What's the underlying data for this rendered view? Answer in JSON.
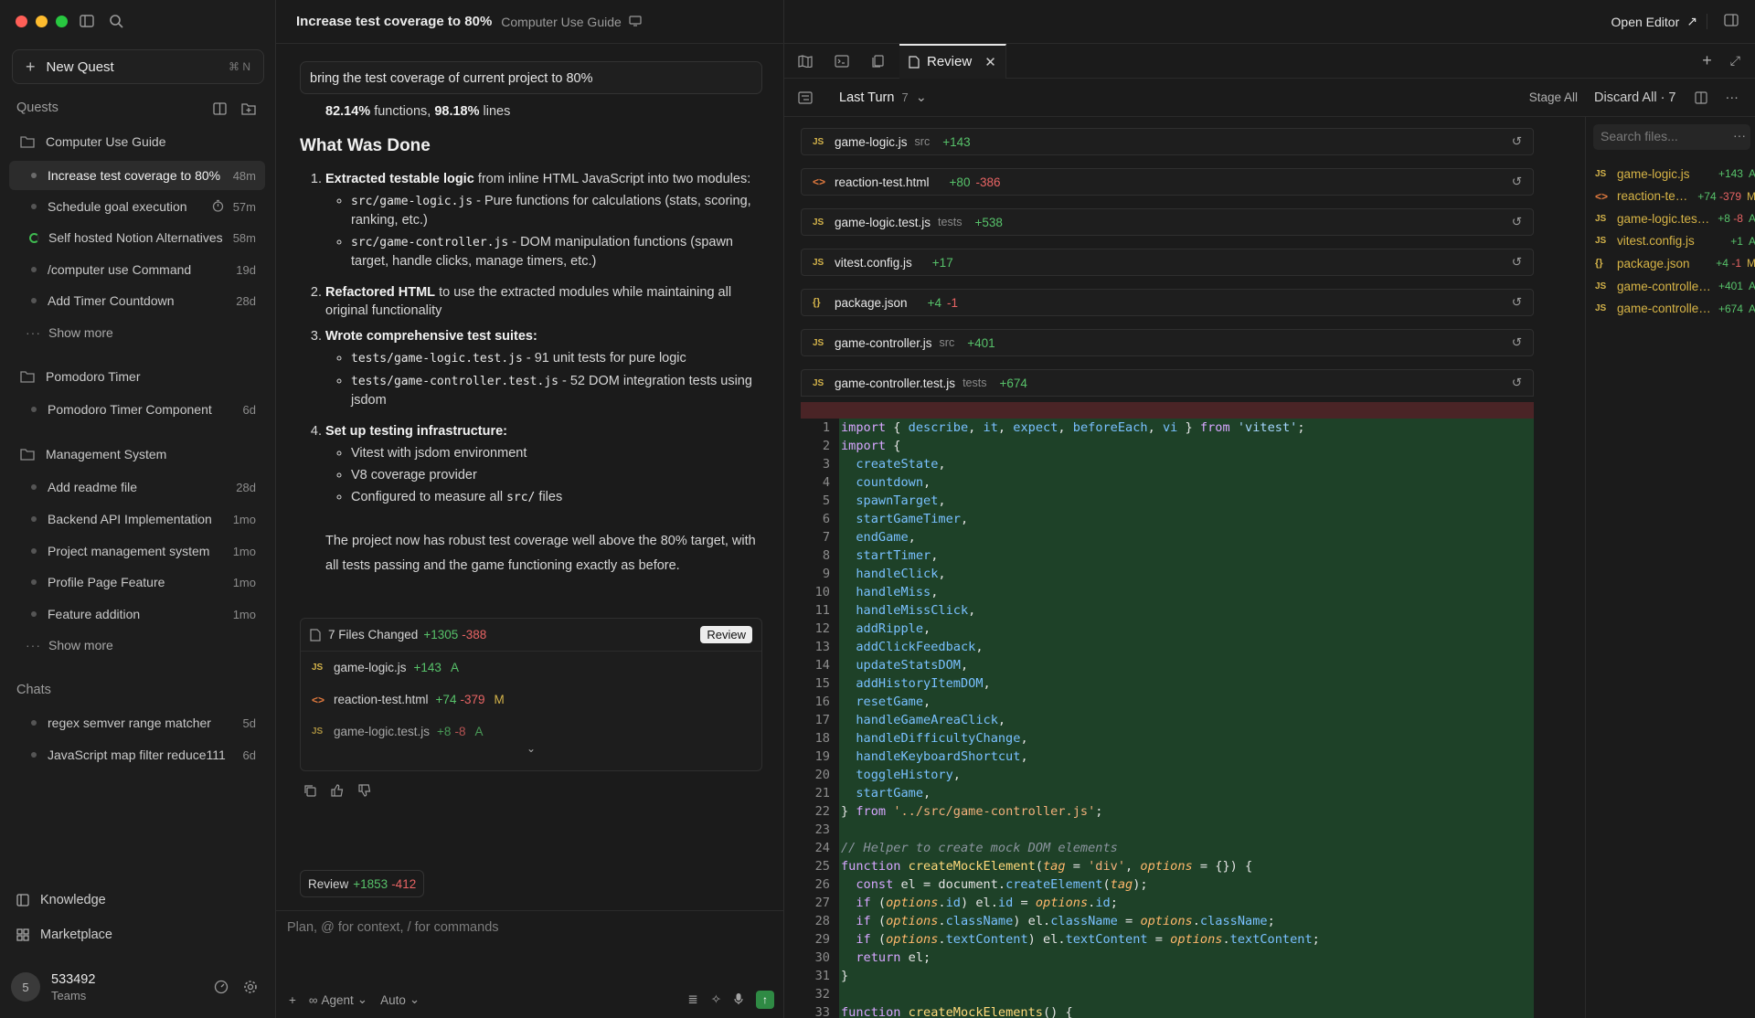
{
  "sidebar": {
    "new_quest": "New Quest",
    "new_quest_kbd": "⌘ N",
    "quests_title": "Quests",
    "groups": [
      {
        "title": "Computer Use Guide",
        "items": [
          {
            "label": "Increase test coverage to 80%",
            "when": "48m",
            "active": true
          },
          {
            "label": "Schedule goal execution",
            "when": "57m"
          },
          {
            "label": "Self hosted Notion Alternatives",
            "when": "58m"
          },
          {
            "label": "/computer use Command",
            "when": "19d"
          },
          {
            "label": "Add Timer Countdown",
            "when": "28d"
          }
        ]
      },
      {
        "title": "Pomodoro Timer",
        "items": [
          {
            "label": "Pomodoro Timer Component",
            "when": "6d"
          }
        ]
      },
      {
        "title": "Management System",
        "items": [
          {
            "label": "Add readme file",
            "when": "28d"
          },
          {
            "label": "Backend API Implementation",
            "when": "1mo"
          },
          {
            "label": "Project management system",
            "when": "1mo"
          },
          {
            "label": "Profile Page Feature",
            "when": "1mo"
          },
          {
            "label": "Feature addition",
            "when": "1mo"
          }
        ]
      }
    ],
    "show_more": "Show more",
    "chats_title": "Chats",
    "chats": [
      {
        "label": "regex semver range matcher",
        "when": "5d"
      },
      {
        "label": "JavaScript map filter reduce111",
        "when": "6d"
      }
    ],
    "knowledge": "Knowledge",
    "marketplace": "Marketplace",
    "user": {
      "initial": "5",
      "name": "533492",
      "team": "Teams"
    }
  },
  "titlebar": {
    "title": "Increase test coverage to 80%",
    "project": "Computer Use Guide",
    "open_editor": "Open Editor"
  },
  "chat": {
    "prompt": "bring the test coverage of current project to 80%",
    "stats_pct_functions": "82.14%",
    "stats_functions_label": "functions,",
    "stats_pct_lines": "98.18%",
    "stats_lines_label": "lines",
    "heading": "What Was Done",
    "step1_b": "Extracted testable logic",
    "step1_t": "from inline HTML JavaScript into two modules:",
    "step1_a_code": "src/game-logic.js",
    "step1_a_t": " - Pure functions for calculations (stats, scoring, ranking, etc.)",
    "step1_b_code": "src/game-controller.js",
    "step1_b_t": " - DOM manipulation functions (spawn target, handle clicks, manage timers, etc.)",
    "step2_b": "Refactored HTML",
    "step2_t": " to use the extracted modules while maintaining all original functionality",
    "step3_b": "Wrote comprehensive test suites:",
    "step3_a_code": "tests/game-logic.test.js",
    "step3_a_t": " - 91 unit tests for pure logic",
    "step3_b_code": "tests/game-controller.test.js",
    "step3_b_t": " - 52 DOM integration tests using jsdom",
    "step4_b": "Set up testing infrastructure:",
    "step4_a": "Vitest with jsdom environment",
    "step4_b2": "V8 coverage provider",
    "step4_c_pre": "Configured to measure all ",
    "step4_c_code": "src/",
    "step4_c_post": " files",
    "conclusion": "The project now has robust test coverage well above the 80% target, with all tests passing and the game functioning exactly as before.",
    "files_changed": "7 Files Changed",
    "files_add": "+1305",
    "files_del": "-388",
    "review_btn": "Review",
    "card_files": [
      {
        "icon": "JS",
        "name": "game-logic.js",
        "add": "+143",
        "del": "",
        "status": "A"
      },
      {
        "icon": "<>",
        "name": "reaction-test.html",
        "add": "+74",
        "del": "-379",
        "status": "M"
      },
      {
        "icon": "JS",
        "name": "game-logic.test.js",
        "add": "+8",
        "del": "-8",
        "status": "A"
      }
    ],
    "review_chip": "Review",
    "review_add": "+1853",
    "review_del": "-412",
    "composer_placeholder": "Plan, @ for context, / for commands",
    "agent": "Agent",
    "auto": "Auto"
  },
  "review": {
    "tab": "Review",
    "last_turn": "Last Turn",
    "last_turn_count": "7",
    "stage_all": "Stage All",
    "discard_all": "Discard All · 7",
    "files": [
      {
        "icon": "JS",
        "name": "game-logic.js",
        "dir": "src",
        "add": "+143",
        "del": ""
      },
      {
        "icon": "<>",
        "name": "reaction-test.html",
        "dir": "",
        "add": "+80",
        "del": "-386"
      },
      {
        "icon": "JS",
        "name": "game-logic.test.js",
        "dir": "tests",
        "add": "+538",
        "del": ""
      },
      {
        "icon": "JS",
        "name": "vitest.config.js",
        "dir": "",
        "add": "+17",
        "del": ""
      },
      {
        "icon": "{}",
        "name": "package.json",
        "dir": "",
        "add": "+4",
        "del": "-1"
      },
      {
        "icon": "JS",
        "name": "game-controller.js",
        "dir": "src",
        "add": "+401",
        "del": ""
      },
      {
        "icon": "JS",
        "name": "game-controller.test.js",
        "dir": "tests",
        "add": "+674",
        "del": ""
      }
    ],
    "search_placeholder": "Search files...",
    "side_files": [
      {
        "icon": "JS",
        "name": "game-logic.js",
        "diff": "+143",
        "status": "A"
      },
      {
        "icon": "<>",
        "name": "reaction-test...",
        "diff": "+74 -379",
        "status": "M"
      },
      {
        "icon": "JS",
        "name": "game-logic.test.js",
        "diff": "+8 -8",
        "status": "A"
      },
      {
        "icon": "JS",
        "name": "vitest.config.js",
        "diff": "+1",
        "status": "A"
      },
      {
        "icon": "{}",
        "name": "package.json",
        "diff": "+4 -1",
        "status": "M"
      },
      {
        "icon": "JS",
        "name": "game-controller.js",
        "diff": "+401",
        "status": "A"
      },
      {
        "icon": "JS",
        "name": "game-controller....",
        "diff": "+674",
        "status": "A"
      }
    ],
    "code_lines": [
      "import { describe, it, expect, beforeEach, vi } from 'vitest';",
      "import {",
      "  createState,",
      "  countdown,",
      "  spawnTarget,",
      "  startGameTimer,",
      "  endGame,",
      "  startTimer,",
      "  handleClick,",
      "  handleMiss,",
      "  handleMissClick,",
      "  addRipple,",
      "  addClickFeedback,",
      "  updateStatsDOM,",
      "  addHistoryItemDOM,",
      "  resetGame,",
      "  handleGameAreaClick,",
      "  handleDifficultyChange,",
      "  handleKeyboardShortcut,",
      "  toggleHistory,",
      "  startGame,",
      "} from '../src/game-controller.js';",
      "",
      "// Helper to create mock DOM elements",
      "function createMockElement(tag = 'div', options = {}) {",
      "  const el = document.createElement(tag);",
      "  if (options.id) el.id = options.id;",
      "  if (options.className) el.className = options.className;",
      "  if (options.textContent) el.textContent = options.textContent;",
      "  return el;",
      "}",
      "",
      "function createMockElements() {"
    ]
  }
}
